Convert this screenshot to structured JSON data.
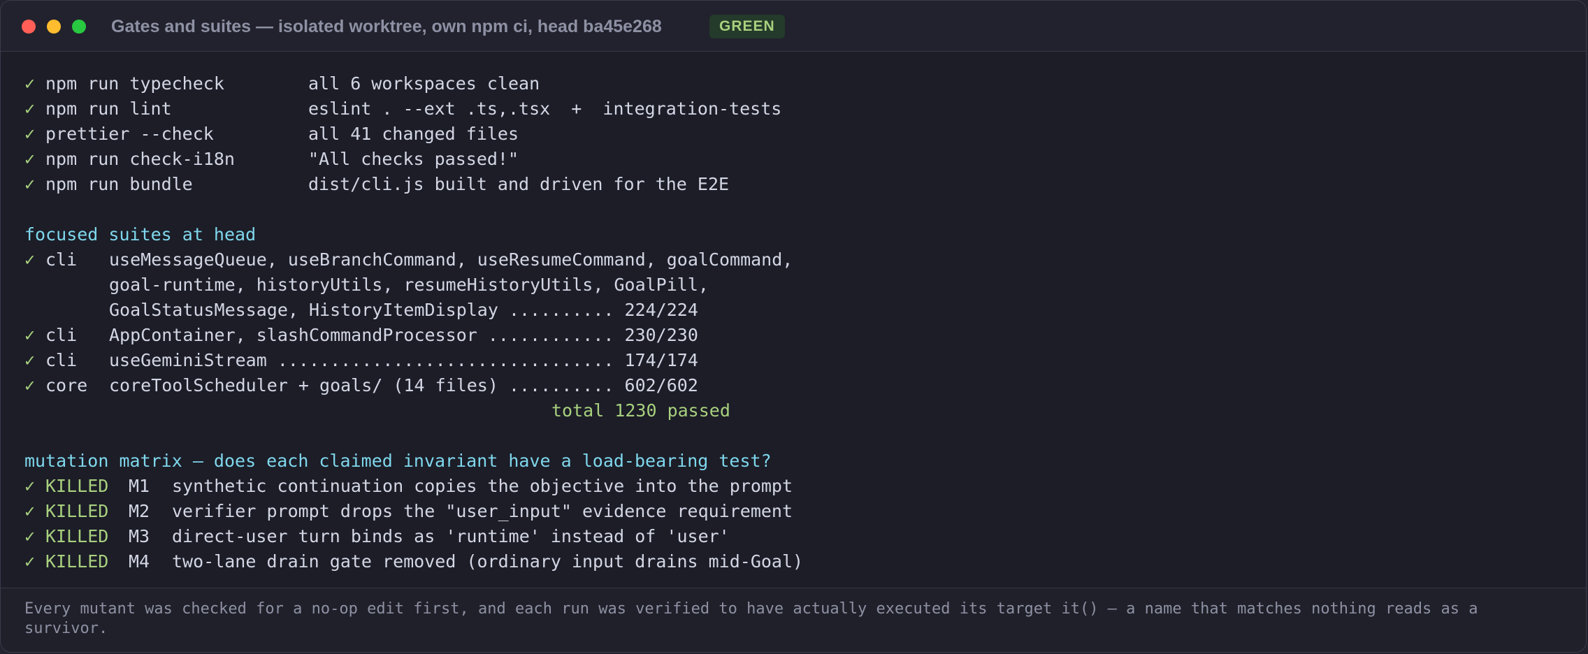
{
  "window": {
    "title": "Gates and suites — isolated worktree, own npm ci, head ba45e268",
    "status_badge": "GREEN",
    "colors": {
      "close": "#ff5f57",
      "minimize": "#febc2e",
      "zoom": "#28c840",
      "accent_green": "#a8d07e",
      "accent_cyan": "#7fd7ec"
    }
  },
  "check_mark": "✓",
  "gates": [
    {
      "command": "npm run typecheck",
      "result": "all 6 workspaces clean"
    },
    {
      "command": "npm run lint",
      "result": "eslint . --ext .ts,.tsx  +  integration-tests"
    },
    {
      "command": "prettier --check",
      "result": "all 41 changed files"
    },
    {
      "command": "npm run check-i18n",
      "result": "\"All checks passed!\""
    },
    {
      "command": "npm run bundle",
      "result": "dist/cli.js built and driven for the E2E"
    }
  ],
  "suites": {
    "heading": "focused suites at head",
    "rows": [
      {
        "package": "cli",
        "lines": [
          "useMessageQueue, useBranchCommand, useResumeCommand, goalCommand,",
          "goal-runtime, historyUtils, resumeHistoryUtils, GoalPill,",
          "GoalStatusMessage, HistoryItemDisplay .......... 224/224"
        ]
      },
      {
        "package": "cli",
        "lines": [
          "AppContainer, slashCommandProcessor ............ 230/230"
        ]
      },
      {
        "package": "cli",
        "lines": [
          "useGeminiStream ................................ 174/174"
        ]
      },
      {
        "package": "core",
        "lines": [
          "coreToolScheduler + goals/ (14 files) .......... 602/602"
        ]
      }
    ],
    "total": "total 1230 passed"
  },
  "mutation": {
    "heading": "mutation matrix — does each claimed invariant have a load-bearing test?",
    "rows": [
      {
        "status": "KILLED",
        "id": "M1",
        "description": "synthetic continuation copies the objective into the prompt"
      },
      {
        "status": "KILLED",
        "id": "M2",
        "description": "verifier prompt drops the \"user_input\" evidence requirement"
      },
      {
        "status": "KILLED",
        "id": "M3",
        "description": "direct-user turn binds as 'runtime' instead of 'user'"
      },
      {
        "status": "KILLED",
        "id": "M4",
        "description": "two-lane drain gate removed (ordinary input drains mid-Goal)"
      }
    ]
  },
  "footer": "Every mutant was checked for a no-op edit first, and each run was verified to have actually executed its target it() — a name that matches nothing reads as a survivor."
}
